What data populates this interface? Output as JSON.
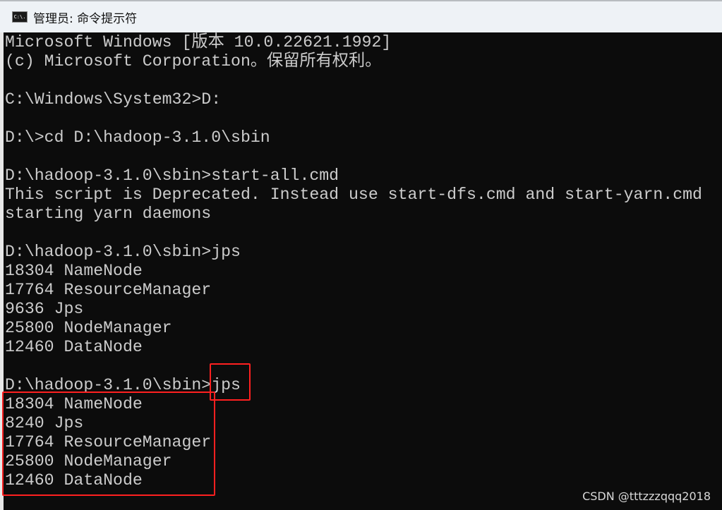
{
  "window": {
    "title": "管理员: 命令提示符",
    "icon": "cmd-icon",
    "icon_text": "C:\\."
  },
  "console": {
    "lines": [
      "Microsoft Windows [版本 10.0.22621.1992]",
      "(c) Microsoft Corporation。保留所有权利。",
      "",
      "C:\\Windows\\System32>D:",
      "",
      "D:\\>cd D:\\hadoop-3.1.0\\sbin",
      "",
      "D:\\hadoop-3.1.0\\sbin>start-all.cmd",
      "This script is Deprecated. Instead use start-dfs.cmd and start-yarn.cmd",
      "starting yarn daemons",
      "",
      "D:\\hadoop-3.1.0\\sbin>jps",
      "18304 NameNode",
      "17764 ResourceManager",
      "9636 Jps",
      "25800 NodeManager",
      "12460 DataNode",
      "",
      "D:\\hadoop-3.1.0\\sbin>jps",
      "18304 NameNode",
      "8240 Jps",
      "17764 ResourceManager",
      "25800 NodeManager",
      "12460 DataNode"
    ]
  },
  "colors": {
    "background": "#0c0c0c",
    "text": "#cccccc",
    "highlight": "#ff2020"
  },
  "watermark": "CSDN @tttzzzqqq2018"
}
